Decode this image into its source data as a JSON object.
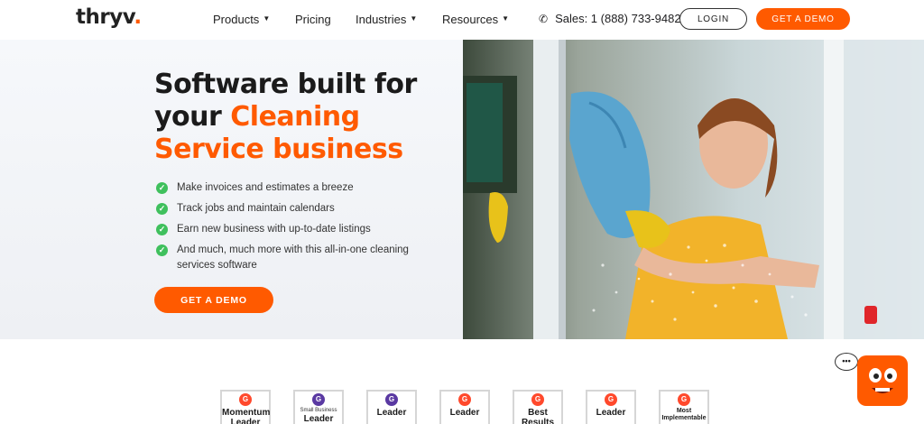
{
  "header": {
    "logo": "thryv",
    "nav": [
      {
        "label": "Products",
        "dropdown": true
      },
      {
        "label": "Pricing",
        "dropdown": false
      },
      {
        "label": "Industries",
        "dropdown": true
      },
      {
        "label": "Resources",
        "dropdown": true
      }
    ],
    "phone": "Sales: 1 (888) 733-9482",
    "login_label": "LOGIN",
    "demo_label": "GET A DEMO"
  },
  "hero": {
    "headline_1": "Software built for",
    "headline_2": "your ",
    "headline_highlight": "Cleaning Service business",
    "checklist": [
      "Make invoices and estimates a breeze",
      "Track jobs and maintain calendars",
      "Earn new business with up-to-date listings",
      "And much, much more with this all-in-one cleaning services software"
    ],
    "cta_label": "GET A DEMO"
  },
  "badges": [
    {
      "sub": "",
      "big": "Momentum Leader",
      "color": "red"
    },
    {
      "sub": "Small Business",
      "big": "Leader",
      "color": "purple"
    },
    {
      "sub": "",
      "big": "Leader",
      "color": "purple"
    },
    {
      "sub": "",
      "big": "Leader",
      "color": "red"
    },
    {
      "sub": "",
      "big": "Best Results",
      "color": "red"
    },
    {
      "sub": "",
      "big": "Leader",
      "color": "red"
    },
    {
      "sub": "",
      "big": "Most Implementable",
      "color": "red"
    }
  ],
  "colors": {
    "brand_orange": "#ff5a00",
    "check_green": "#3fc05d",
    "g2_red": "#ff492c",
    "g2_purple": "#5a39a2"
  }
}
